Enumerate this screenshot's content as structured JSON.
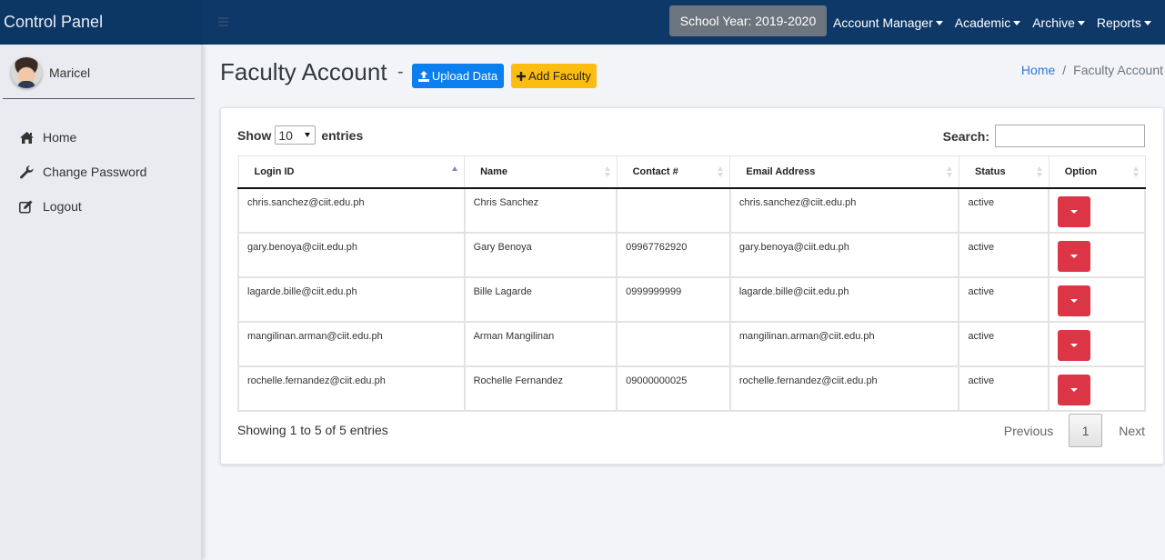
{
  "header": {
    "brand": "Control Panel",
    "school_year": "School Year: 2019-2020",
    "nav": [
      {
        "label": "Account Manager"
      },
      {
        "label": "Academic"
      },
      {
        "label": "Archive"
      },
      {
        "label": "Reports"
      }
    ]
  },
  "sidebar": {
    "user_name": "Maricel",
    "items": [
      {
        "label": "Home",
        "icon": "home-icon"
      },
      {
        "label": "Change Password",
        "icon": "wrench-icon"
      },
      {
        "label": "Logout",
        "icon": "edit-icon"
      }
    ]
  },
  "page": {
    "title": "Faculty Account",
    "dash": "-",
    "upload_label": "Upload Data",
    "add_label": "Add Faculty",
    "breadcrumb": {
      "home": "Home",
      "separator": "/",
      "current": "Faculty Account"
    }
  },
  "table_controls": {
    "show_label": "Show",
    "entries_label": "entries",
    "page_length": "10",
    "search_label": "Search:",
    "search_value": ""
  },
  "table": {
    "columns": [
      {
        "label": "Login ID",
        "sort": "asc"
      },
      {
        "label": "Name",
        "sort": "none"
      },
      {
        "label": "Contact #",
        "sort": "none"
      },
      {
        "label": "Email Address",
        "sort": "none"
      },
      {
        "label": "Status",
        "sort": "none"
      },
      {
        "label": "Option",
        "sort": "none"
      }
    ],
    "rows": [
      {
        "login_id": "chris.sanchez@ciit.edu.ph",
        "name": "Chris Sanchez",
        "contact": "",
        "email": "chris.sanchez@ciit.edu.ph",
        "status": "active"
      },
      {
        "login_id": "gary.benoya@ciit.edu.ph",
        "name": "Gary Benoya",
        "contact": "09967762920",
        "email": "gary.benoya@ciit.edu.ph",
        "status": "active"
      },
      {
        "login_id": "lagarde.bille@ciit.edu.ph",
        "name": "Bille Lagarde",
        "contact": "0999999999",
        "email": "lagarde.bille@ciit.edu.ph",
        "status": "active"
      },
      {
        "login_id": "mangilinan.arman@ciit.edu.ph",
        "name": "Arman Mangilinan",
        "contact": "",
        "email": "mangilinan.arman@ciit.edu.ph",
        "status": "active"
      },
      {
        "login_id": "rochelle.fernandez@ciit.edu.ph",
        "name": "Rochelle Fernandez",
        "contact": "09000000025",
        "email": "rochelle.fernandez@ciit.edu.ph",
        "status": "active"
      }
    ]
  },
  "footer": {
    "info": "Showing 1 to 5 of 5 entries",
    "previous": "Previous",
    "current_page": "1",
    "next": "Next"
  },
  "colors": {
    "topbar": "#0d3868",
    "upload_button": "#0b7fee",
    "add_button": "#fbbd12",
    "option_button": "#dc3545",
    "school_year_badge": "#6c757d"
  }
}
